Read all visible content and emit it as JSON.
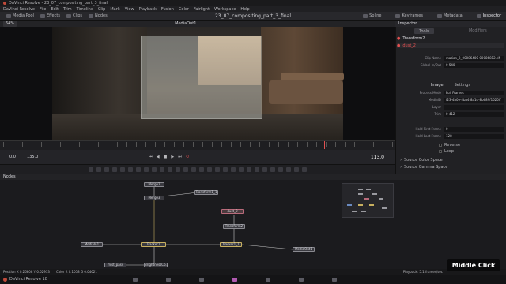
{
  "window": {
    "app": "DaVinci Resolve",
    "title": "DaVinci Resolve - 23_07_compositing_part_3_final"
  },
  "menu": [
    "DaVinci Resolve",
    "File",
    "Edit",
    "Trim",
    "Timeline",
    "Clip",
    "Mark",
    "View",
    "Playback",
    "Fusion",
    "Color",
    "Fairlight",
    "Workspace",
    "Help"
  ],
  "toolbar": {
    "media_pool": "Media Pool",
    "effects": "Effects",
    "clips": "Clips",
    "nodes": "Nodes",
    "project_title": "23_07_compositing_part_3_final",
    "spline": "Spline",
    "keyframes": "Keyframes",
    "metadata": "Metadata",
    "inspector": "Inspector"
  },
  "viewer": {
    "zoom": "64%",
    "label": "MediaOut1"
  },
  "transport": {
    "start": "0.0",
    "end": "135.0",
    "current": "113.0"
  },
  "nodes_panel": {
    "title": "Nodes"
  },
  "nodes": [
    {
      "label": "Merge2"
    },
    {
      "label": "Merge3"
    },
    {
      "label": "Transform1_1"
    },
    {
      "label": "dust_2"
    },
    {
      "label": "Transform2"
    },
    {
      "label": "MediaIn1"
    },
    {
      "label": "Tracker1"
    },
    {
      "label": "Tracker1_1"
    },
    {
      "label": "MediaOut1"
    },
    {
      "label": "mist_pass"
    },
    {
      "label": "BrightnessCo..."
    }
  ],
  "inspector": {
    "title": "Inspector",
    "tabs": [
      "Tools",
      "Modifiers"
    ],
    "items": [
      {
        "name": "Transform2"
      },
      {
        "name": "dust_2"
      }
    ],
    "subtabs": [
      "Image",
      "Settings"
    ],
    "fields": [
      {
        "label": "Clip Name",
        "value": "mation_2_00086400-00086812.tif"
      },
      {
        "label": "Global In/Out",
        "value": "0    540"
      },
      {
        "label": "Process Mode",
        "value": "Full Frames"
      },
      {
        "label": "MediaID",
        "value": "f23-4b0e-4ba4-8a1d-8b689f1525ff"
      },
      {
        "label": "Layer",
        "value": ""
      },
      {
        "label": "Trim",
        "value": "0    412"
      },
      {
        "label": "Hold First Frame",
        "value": "0"
      },
      {
        "label": "Hold Last Frame",
        "value": "128"
      }
    ],
    "checkboxes": [
      "Reverse",
      "Loop"
    ],
    "sections": [
      "Source Color Space",
      "Source Gamma Space"
    ]
  },
  "statusbar": {
    "position": "Position  X 0.26808   Y 0.52933",
    "color": "Color  R 0.1058   G 0.04621",
    "playback": "Playback: 5.1 frames/sec"
  },
  "footer": {
    "product": "DaVinci Resolve 18"
  },
  "tooltip": "Middle Click"
}
